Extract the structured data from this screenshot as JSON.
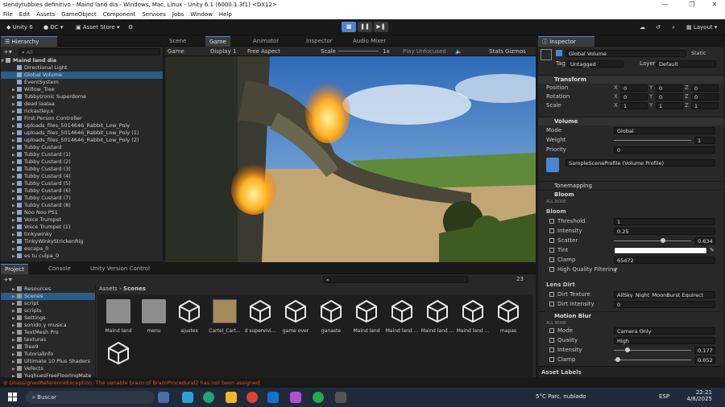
{
  "window": {
    "title": "slendytubbies  definitivo - Maind land dia - Windows, Mac, Linux - Unity 6.1 (6000.1.3f1) <DX12>"
  },
  "menu": [
    "File",
    "Edit",
    "Assets",
    "GameObject",
    "Component",
    "Services",
    "Jobs",
    "Window",
    "Help"
  ],
  "toolbar": {
    "unity_label": "Unity 6",
    "account": "DC",
    "asset_store": "Asset Store",
    "layout": "Layout"
  },
  "hierarchy": {
    "tab": "Hierarchy",
    "search_placeholder": "All",
    "root": "Maind land dia",
    "items": [
      "Directional Light",
      "Global Volume",
      "EventSystem",
      "Willow_Tree",
      "Tubbytronic Superdome",
      "dead laalaa",
      "rickastley.x",
      "First Person Controller",
      "uploads_files_5014646_Rabbit_Low_Poly",
      "uploads_files_5014646_Rabbit_Low_Poly (1)",
      "uploads_files_5014646_Rabbit_Low_Poly (2)",
      "Tubby Custard",
      "Tubby Custard (1)",
      "Tubby Custard (2)",
      "Tubby Custard (3)",
      "Tubby Custard (4)",
      "Tubby Custard (5)",
      "Tubby Custard (6)",
      "Tubby Custard (7)",
      "Tubby Custard (8)",
      "Noo Noo PS1",
      "Voice Trumpet",
      "Voice Trumpet (1)",
      "tinkywinky",
      "TinkyWinkyStrickenRig",
      "escapa_0",
      "es tu culpa_0"
    ]
  },
  "center_tabs": [
    "Scene",
    "Game",
    "Animator",
    "Inspector",
    "Audio Mixer"
  ],
  "game_bar": {
    "mode": "Game",
    "display": "Display 1",
    "aspect": "Free Aspect",
    "scale_label": "Scale",
    "scale_val": "1x",
    "play_mode": "Play Unfocused",
    "stats": "Stats",
    "gizmos": "Gizmos"
  },
  "project": {
    "tabs": [
      "Project",
      "Console",
      "Unity Version Control"
    ],
    "breadcrumb": [
      "Assets",
      "Scenes"
    ],
    "count": "23",
    "folders": [
      "Resources",
      "Scenes",
      "script",
      "scripts",
      "Settings",
      "sonido y musica",
      "TextMesh Pro",
      "texturas",
      "Tree9",
      "TutorialInfo",
      "Ultimate 10 Plus Shaders",
      "Vefects",
      "YughuesFreeFlooringMate"
    ],
    "assets": [
      "Maind land",
      "menu",
      "ajustes",
      "Cartel_Cart...",
      "d supervivi...",
      "game over",
      "ganaste",
      "Maind land",
      "Maind land ...",
      "Maind land ...",
      "Maind land ...",
      "mapas",
      ""
    ]
  },
  "inspector": {
    "tab": "Inspector",
    "object_name": "Global Volume",
    "static": "Static",
    "tag_label": "Tag",
    "tag": "Untagged",
    "layer_label": "Layer",
    "layer": "Default",
    "transform": {
      "title": "Transform",
      "position": [
        "0",
        "0",
        "0"
      ],
      "rotation": [
        "0",
        "0",
        "0"
      ],
      "scale": [
        "1",
        "1",
        "1"
      ],
      "labels": [
        "Position",
        "Rotation",
        "Scale"
      ]
    },
    "volume": {
      "title": "Volume",
      "mode_label": "Mode",
      "mode": "Global",
      "weight_label": "Weight",
      "weight": "1",
      "priority_label": "Priority",
      "priority": "0",
      "profile": "SampleSceneProfile (Volume Profile)"
    },
    "tonemapping": "Tonemapping",
    "bloom": {
      "title": "Bloom",
      "all_none": "ALL  NONE",
      "section": "Bloom",
      "threshold_label": "Threshold",
      "threshold": "1",
      "intensity_label": "Intensity",
      "intensity": "0.25",
      "scatter_label": "Scatter",
      "scatter": "0.634",
      "tint_label": "Tint",
      "clamp_label": "Clamp",
      "clamp": "65472",
      "hq_label": "High Quality Filtering"
    },
    "lens_dirt": {
      "title": "Lens Dirt",
      "texture_label": "Dirt Texture",
      "texture": "AllSky_Night_MoonBurst Equirect",
      "intensity_label": "Dirt Intensity",
      "intensity": "0"
    },
    "motion_blur": {
      "title": "Motion Blur",
      "all_none": "ALL  NONE",
      "mode_label": "Mode",
      "mode": "Camera Only",
      "quality_label": "Quality",
      "quality": "High",
      "intensity_label": "Intensity",
      "intensity": "0.177",
      "clamp_label": "Clamp",
      "clamp": "0.052"
    },
    "asset_labels": "Asset Labels"
  },
  "status": {
    "error": "UnassignedReferenceException: The variable brazo of BrazoProcedural2 has not been assigned."
  },
  "taskbar": {
    "search": "Buscar",
    "weather": "5°C  Parc. nublado",
    "lang": "ESP",
    "time": "22:21",
    "date": "4/8/2025"
  }
}
